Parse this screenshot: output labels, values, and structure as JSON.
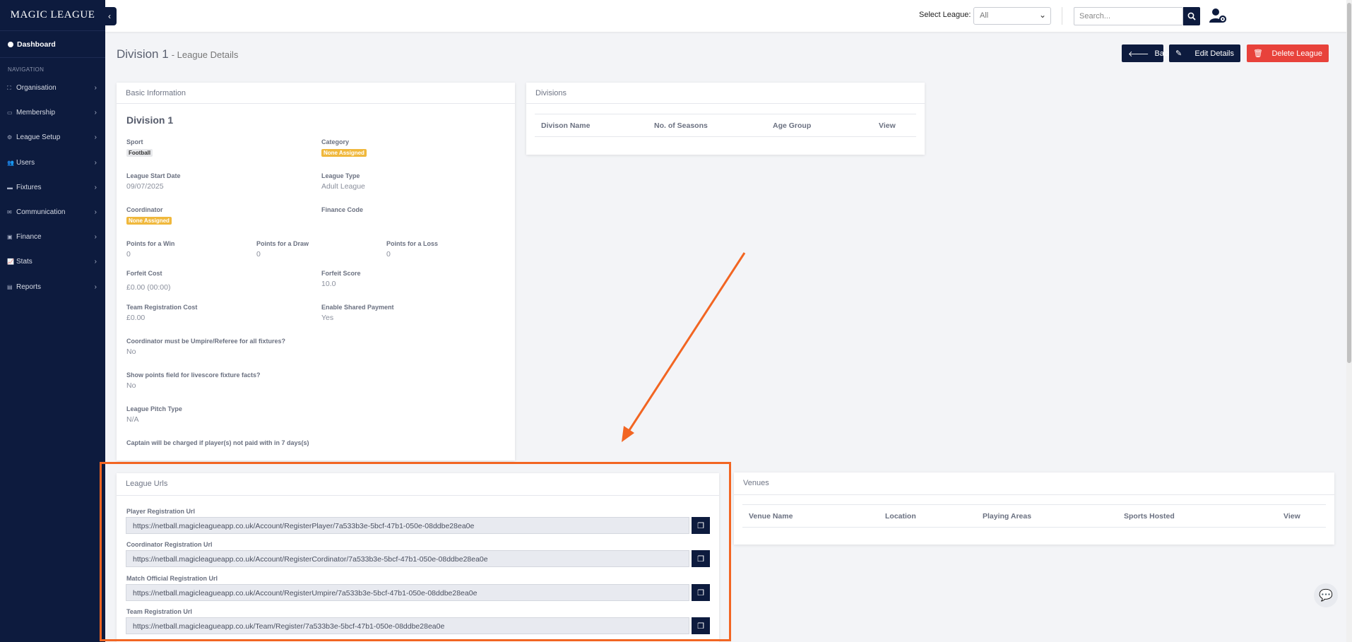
{
  "app": {
    "logo": "MAGIC LEAGUE",
    "collapse_icon": "‹"
  },
  "sidebar": {
    "dashboard": "Dashboard",
    "nav_heading": "NAVIGATION",
    "items": [
      {
        "label": "Organisation",
        "icon": "org-icon"
      },
      {
        "label": "Membership",
        "icon": "membership-icon"
      },
      {
        "label": "League Setup",
        "icon": "league-setup-icon"
      },
      {
        "label": "Users",
        "icon": "users-icon"
      },
      {
        "label": "Fixtures",
        "icon": "fixtures-icon"
      },
      {
        "label": "Communication",
        "icon": "communication-icon"
      },
      {
        "label": "Finance",
        "icon": "finance-icon"
      },
      {
        "label": "Stats",
        "icon": "stats-icon"
      },
      {
        "label": "Reports",
        "icon": "reports-icon"
      }
    ]
  },
  "topbar": {
    "select_label": "Select League:",
    "select_value": "All",
    "search_placeholder": "Search..."
  },
  "page": {
    "title": "Division 1",
    "subtitle": "- League Details",
    "back_label": "Back",
    "edit_label": "Edit Details",
    "delete_label": "Delete League"
  },
  "basic": {
    "header": "Basic Information",
    "name": "Division 1",
    "sport_label": "Sport",
    "sport_value": "Football",
    "category_label": "Category",
    "category_value": "None Assigned",
    "start_label": "League Start Date",
    "start_value": "09/07/2025",
    "type_label": "League Type",
    "type_value": "Adult League",
    "coordinator_label": "Coordinator",
    "coordinator_value": "None Assigned",
    "finance_label": "Finance Code",
    "win_label": "Points for a Win",
    "win_value": "0",
    "draw_label": "Points for a Draw",
    "draw_value": "0",
    "loss_label": "Points for a Loss",
    "loss_value": "0",
    "forfeit_cost_label": "Forfeit Cost",
    "forfeit_cost_value": "£0.00 (00:00)",
    "forfeit_score_label": "Forfeit Score",
    "forfeit_score_value": "10.0",
    "team_cost_label": "Team Registration Cost",
    "team_cost_value": "£0.00",
    "shared_label": "Enable Shared Payment",
    "shared_value": "Yes",
    "umpire_label": "Coordinator must be Umpire/Referee for all fixtures?",
    "umpire_value": "No",
    "livescore_label": "Show points field for livescore fixture facts?",
    "livescore_value": "No",
    "pitch_label": "League Pitch Type",
    "pitch_value": "N/A",
    "captain_label": "Captain will be charged if player(s) not paid with in 7 days(s)"
  },
  "divisions": {
    "header": "Divisions",
    "columns": [
      "Divison Name",
      "No. of Seasons",
      "Age Group",
      "View"
    ]
  },
  "urls": {
    "header": "League Urls",
    "items": [
      {
        "label": "Player Registration Url",
        "value": "https://netball.magicleagueapp.co.uk/Account/RegisterPlayer/7a533b3e-5bcf-47b1-050e-08ddbe28ea0e"
      },
      {
        "label": "Coordinator Registration Url",
        "value": "https://netball.magicleagueapp.co.uk/Account/RegisterCordinator/7a533b3e-5bcf-47b1-050e-08ddbe28ea0e"
      },
      {
        "label": "Match Official Registration Url",
        "value": "https://netball.magicleagueapp.co.uk/Account/RegisterUmpire/7a533b3e-5bcf-47b1-050e-08ddbe28ea0e"
      },
      {
        "label": "Team Registration Url",
        "value": "https://netball.magicleagueapp.co.uk/Team/Register/7a533b3e-5bcf-47b1-050e-08ddbe28ea0e"
      }
    ]
  },
  "venues": {
    "header": "Venues",
    "columns": [
      "Venue Name",
      "Location",
      "Playing Areas",
      "Sports Hosted",
      "View"
    ]
  },
  "colors": {
    "navy": "#0d1b3e",
    "danger": "#e8423b",
    "badge": "#f0b83c",
    "annotation": "#f26522"
  }
}
